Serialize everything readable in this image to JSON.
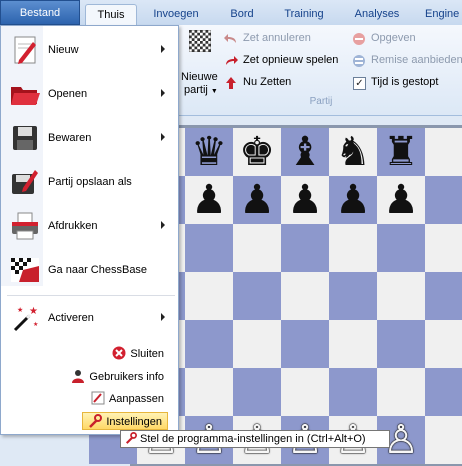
{
  "tabs": [
    {
      "label": "Bestand"
    },
    {
      "label": "Thuis"
    },
    {
      "label": "Invoegen"
    },
    {
      "label": "Bord"
    },
    {
      "label": "Training"
    },
    {
      "label": "Analyses"
    },
    {
      "label": "Engine"
    }
  ],
  "ribbon": {
    "new_game": {
      "line1": "Nieuwe",
      "line2": "partij"
    },
    "undo": "Zet annuleren",
    "redo": "Zet opnieuw spelen",
    "move_now": "Nu Zetten",
    "resign": "Opgeven",
    "offer_draw": "Remise aanbieden",
    "time_stopped": "Tijd is gestopt",
    "time_stopped_checked": true,
    "group_label": "Partij"
  },
  "menu": {
    "items": [
      {
        "label": "Nieuw",
        "icon": "new-document-icon",
        "submenu": true
      },
      {
        "label": "Openen",
        "icon": "open-folder-icon",
        "submenu": true
      },
      {
        "label": "Bewaren",
        "icon": "save-disk-icon",
        "submenu": true
      },
      {
        "label": "Partij opslaan als",
        "icon": "save-game-as-icon",
        "submenu": false
      },
      {
        "label": "Afdrukken",
        "icon": "printer-icon",
        "submenu": true
      },
      {
        "label": "Ga naar ChessBase",
        "icon": "chessbase-icon",
        "submenu": false
      },
      {
        "label": "Activeren",
        "icon": "magic-wand-icon",
        "submenu": true
      }
    ],
    "bottom": [
      {
        "label": "Sluiten",
        "icon": "close-icon"
      },
      {
        "label": "Gebruikers info",
        "icon": "user-info-icon"
      },
      {
        "label": "Aanpassen",
        "icon": "customize-icon"
      },
      {
        "label": "Instellingen",
        "icon": "settings-icon"
      }
    ]
  },
  "tooltip": "Stel de programma-instellingen in (Ctrl+Alt+O)",
  "board": {
    "colors": {
      "light": "#f0f0f0",
      "dark": "#8d98cc"
    },
    "black_back_rank": [
      "♛",
      "♚",
      "♝",
      "♞",
      "♜"
    ],
    "black_pawn": "♟",
    "white_pawn": "♙"
  }
}
